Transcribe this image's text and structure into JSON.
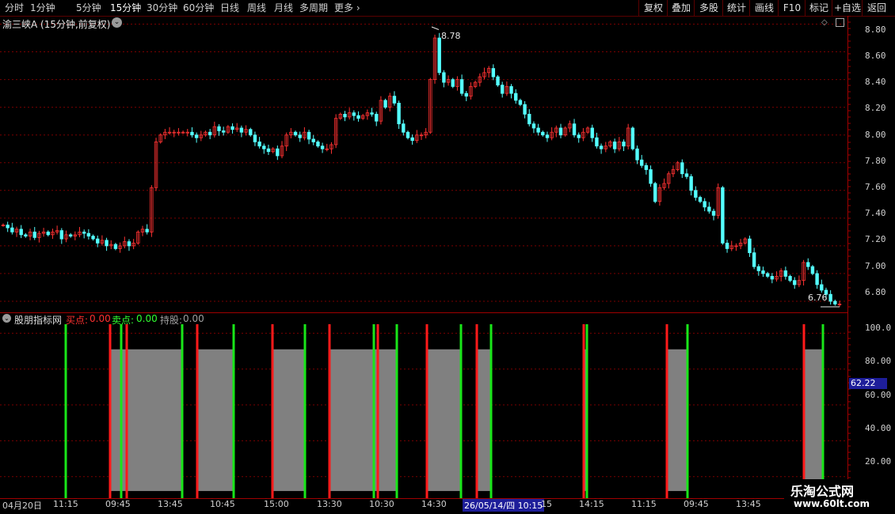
{
  "toolbar": {
    "periods": [
      "分时",
      "1分钟",
      "5分钟",
      "15分钟",
      "30分钟",
      "60分钟",
      "日线",
      "周线",
      "月线",
      "多周期"
    ],
    "active_period": "15分钟",
    "more": "更多",
    "more_icon": "chevron-right-icon",
    "right_buttons": [
      "复权",
      "叠加",
      "多股",
      "统计",
      "画线",
      "F10",
      "标记",
      "+自选",
      "返回"
    ]
  },
  "main_chart": {
    "title": "渝三峡A (15分钟,前复权)",
    "high_label": "8.78",
    "low_label": "6.76"
  },
  "indicator": {
    "name": "股朋指标网",
    "buy_label": "买点:",
    "buy_value": "0.00",
    "sell_label": "卖点:",
    "sell_value": "0.00",
    "hold_label": "持股:",
    "hold_value": "0.00",
    "current_value": "62.22"
  },
  "price_axis": [
    "8.80",
    "8.60",
    "8.40",
    "8.20",
    "8.00",
    "7.80",
    "7.60",
    "7.40",
    "7.20",
    "7.00",
    "6.80"
  ],
  "indicator_axis": [
    "100.0",
    "80.00",
    "60.00",
    "40.00",
    "20.00"
  ],
  "time_axis": [
    "04月20日",
    "11:15",
    "09:45",
    "13:45",
    "10:45",
    "15:00",
    "13:30",
    "10:30",
    "14:30",
    "26/05/14/四 10:15",
    "15",
    "14:15",
    "11:15",
    "09:45",
    "13:45"
  ],
  "watermark": {
    "name": "乐淘公式网",
    "url": "www.60lt.com"
  },
  "colors": {
    "up": "#ff3232",
    "down": "#54ffff",
    "buy_line": "#ff1a1a",
    "sell_line": "#19e619",
    "hold_fill": "#808080",
    "grid": "#7a0000"
  },
  "chart_data": {
    "type": "candlestick",
    "price_axis_range": [
      6.72,
      8.86
    ],
    "close_series": [
      7.35,
      7.33,
      7.3,
      7.32,
      7.28,
      7.27,
      7.3,
      7.26,
      7.29,
      7.3,
      7.28,
      7.3,
      7.31,
      7.25,
      7.28,
      7.27,
      7.28,
      7.3,
      7.29,
      7.27,
      7.25,
      7.22,
      7.24,
      7.2,
      7.21,
      7.18,
      7.2,
      7.23,
      7.2,
      7.22,
      7.3,
      7.32,
      7.3,
      7.62,
      7.95,
      8.0,
      8.02,
      8.02,
      8.02,
      8.02,
      8.02,
      8.02,
      8.0,
      7.98,
      8.0,
      8.02,
      8.0,
      8.06,
      8.03,
      8.02,
      8.06,
      8.04,
      8.05,
      8.02,
      8.04,
      8.0,
      7.95,
      7.92,
      7.9,
      7.88,
      7.9,
      7.85,
      7.92,
      8.0,
      8.02,
      8.0,
      7.98,
      8.02,
      7.97,
      7.95,
      7.92,
      7.9,
      7.9,
      7.93,
      8.12,
      8.15,
      8.13,
      8.16,
      8.14,
      8.12,
      8.14,
      8.16,
      8.15,
      8.1,
      8.25,
      8.2,
      8.28,
      8.23,
      8.08,
      8.02,
      7.98,
      7.96,
      8.0,
      8.0,
      8.02,
      8.4,
      8.7,
      8.45,
      8.38,
      8.4,
      8.35,
      8.4,
      8.3,
      8.28,
      8.35,
      8.38,
      8.42,
      8.45,
      8.48,
      8.42,
      8.36,
      8.3,
      8.35,
      8.3,
      8.25,
      8.22,
      8.15,
      8.08,
      8.05,
      8.02,
      8.0,
      7.98,
      8.02,
      8.05,
      8.0,
      8.05,
      8.08,
      8.0,
      7.98,
      8.02,
      8.05,
      7.98,
      7.92,
      7.9,
      7.92,
      7.95,
      7.9,
      7.95,
      7.92,
      8.05,
      7.9,
      7.82,
      7.78,
      7.75,
      7.65,
      7.52,
      7.62,
      7.65,
      7.72,
      7.75,
      7.8,
      7.72,
      7.7,
      7.6,
      7.55,
      7.52,
      7.48,
      7.45,
      7.42,
      7.62,
      7.22,
      7.18,
      7.2,
      7.2,
      7.22,
      7.25,
      7.15,
      7.05,
      7.02,
      7.0,
      6.98,
      6.96,
      6.98,
      7.02,
      6.98,
      6.95,
      6.92,
      6.95,
      7.08,
      7.05,
      7.0,
      6.92,
      6.88,
      6.85,
      6.8,
      6.78,
      6.78
    ],
    "price_high": 8.78,
    "price_low": 6.76,
    "indicator": {
      "axis_range": [
        8,
        105
      ],
      "buy_points": [
        139,
        160,
        249,
        344,
        416,
        477,
        539,
        602,
        737,
        842,
        1015
      ],
      "sell_points": [
        83,
        153,
        230,
        295,
        385,
        472,
        501,
        582,
        620,
        741,
        868,
        1039
      ],
      "hold_intervals": [
        [
          139,
          230
        ],
        [
          249,
          295
        ],
        [
          344,
          385
        ],
        [
          416,
          501
        ],
        [
          539,
          582
        ],
        [
          602,
          620
        ],
        [
          737,
          741
        ],
        [
          842,
          868
        ],
        [
          1015,
          1039
        ]
      ],
      "hold_level": [
        12,
        91
      ]
    }
  }
}
